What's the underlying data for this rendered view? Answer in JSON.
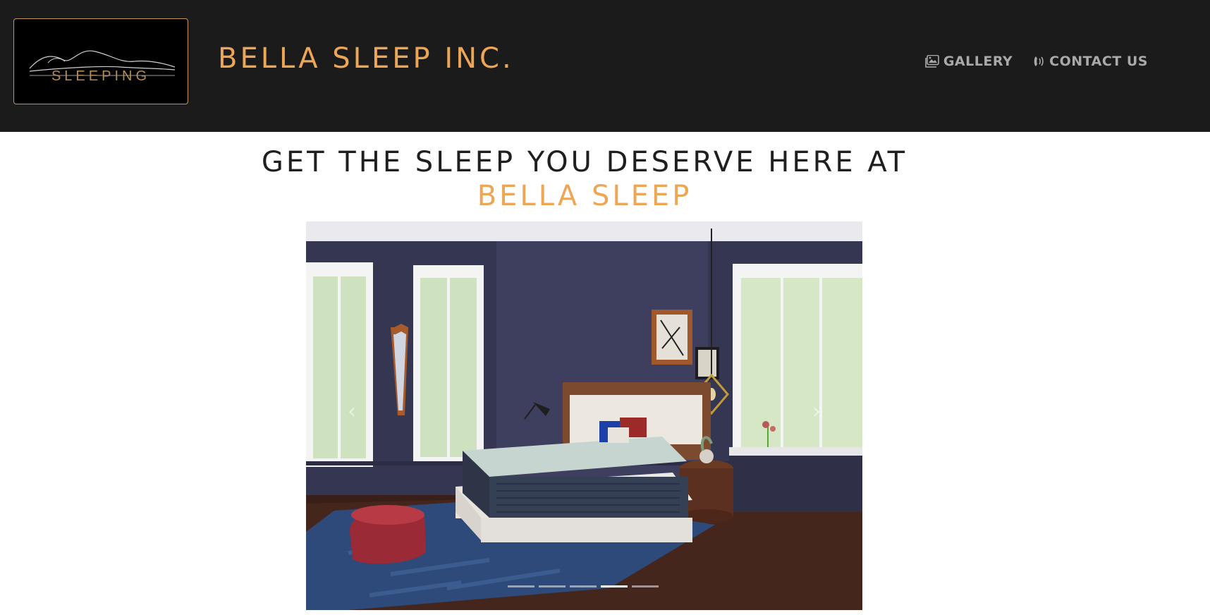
{
  "header": {
    "logo_text": "SLEEPING",
    "brand": "BELLA SLEEP INC.",
    "nav": [
      {
        "label": "GALLERY",
        "icon": "image-gallery-icon"
      },
      {
        "label": "CONTACT US",
        "icon": "phone-volume-icon"
      }
    ]
  },
  "hero": {
    "headline_line1": "GET THE SLEEP YOU DESERVE HERE AT",
    "headline_line2": "BELLA SLEEP"
  },
  "carousel": {
    "image": "bedroom-mattress-photo",
    "slides_total": 5,
    "active_slide": 4,
    "prev_icon": "chevron-left-icon",
    "next_icon": "chevron-right-icon"
  },
  "colors": {
    "header_bg": "#1b1b1b",
    "accent": "#eda656",
    "nav_text": "#a9a9a9",
    "headline": "#1f1f1f"
  }
}
